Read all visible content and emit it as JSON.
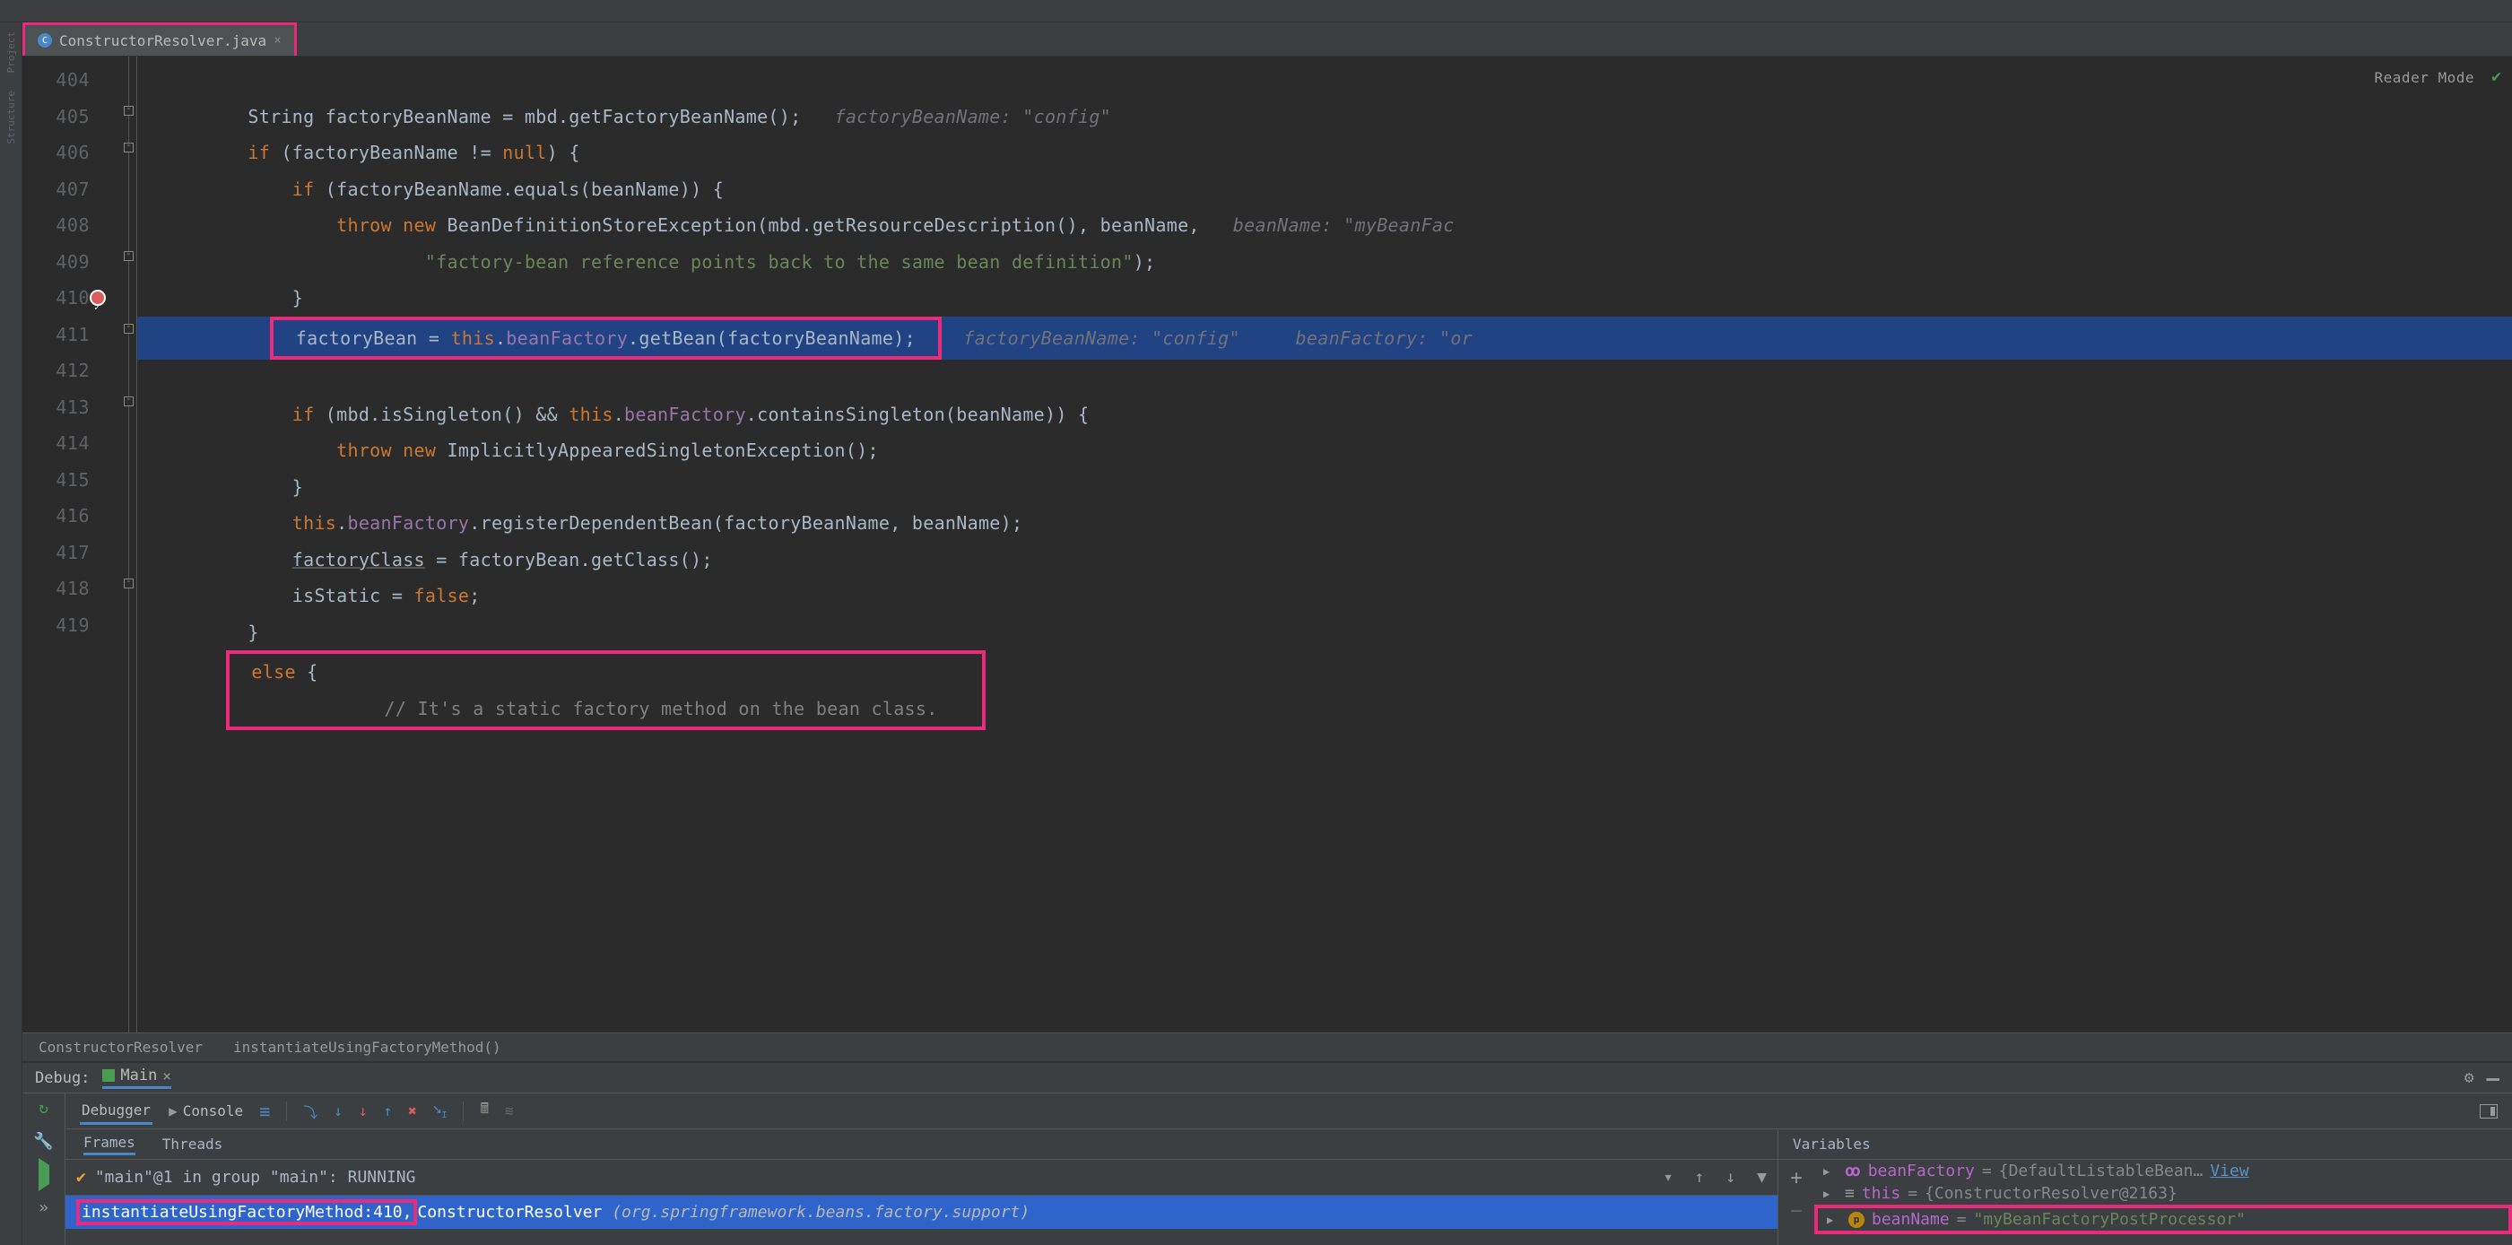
{
  "tab": {
    "filename": "ConstructorResolver.java"
  },
  "reader_mode_label": "Reader Mode",
  "breadcrumbs": {
    "a": "ConstructorResolver",
    "b": "instantiateUsingFactoryMethod()"
  },
  "lines": {
    "404": "404",
    "405": "405",
    "406": "406",
    "407": "407",
    "408": "408",
    "409": "409",
    "410": "410",
    "411": "411",
    "412": "412",
    "413": "413",
    "414": "414",
    "415": "415",
    "416": "416",
    "417": "417",
    "418": "418",
    "419": "419"
  },
  "code": {
    "l404a": "String factoryBeanName = mbd.getFactoryBeanName();   ",
    "l404h": "factoryBeanName: \"config\"",
    "l405": "if (factoryBeanName != null) {",
    "l406": "    if (factoryBeanName.equals(beanName)) {",
    "l407a": "        throw new BeanDefinitionStoreException(mbd.getResourceDescription(), beanName,   ",
    "l407h": "beanName: \"myBeanFac",
    "l408": "                \"factory-bean reference points back to the same bean definition\");",
    "l409": "    }",
    "l410a": "    factoryBean = this.beanFactory.getBean(factoryBeanName);",
    "l410h1": "factoryBeanName: \"config\"",
    "l410h2": "beanFactory: \"or",
    "l411": "    if (mbd.isSingleton() && this.beanFactory.containsSingleton(beanName)) {",
    "l412": "        throw new ImplicitlyAppearedSingletonException();",
    "l413": "    }",
    "l414": "    this.beanFactory.registerDependentBean(factoryBeanName, beanName);",
    "l415": "    factoryClass = factoryBean.getClass();",
    "l416": "    isStatic = false;",
    "l417": "}",
    "l418": "else {",
    "l419": "    // It's a static factory method on the bean class."
  },
  "debug": {
    "label": "Debug:",
    "run_config": "Main",
    "tabs": {
      "debugger": "Debugger",
      "console": "Console"
    },
    "frames_tab": "Frames",
    "threads_tab": "Threads",
    "thread_line": "\"main\"@1 in group \"main\": RUNNING",
    "frame_sel_method": "instantiateUsingFactoryMethod:410,",
    "frame_sel_class": "ConstructorResolver",
    "frame_sel_pkg": "(org.springframework.beans.factory.support)",
    "vars_label": "Variables",
    "var1": {
      "name": "beanFactory",
      "val": "{DefaultListableBean…",
      "link": "View"
    },
    "var2": {
      "name": "this",
      "val": "{ConstructorResolver@2163}"
    },
    "var3": {
      "name": "beanName",
      "val": "\"myBeanFactoryPostProcessor\""
    }
  }
}
